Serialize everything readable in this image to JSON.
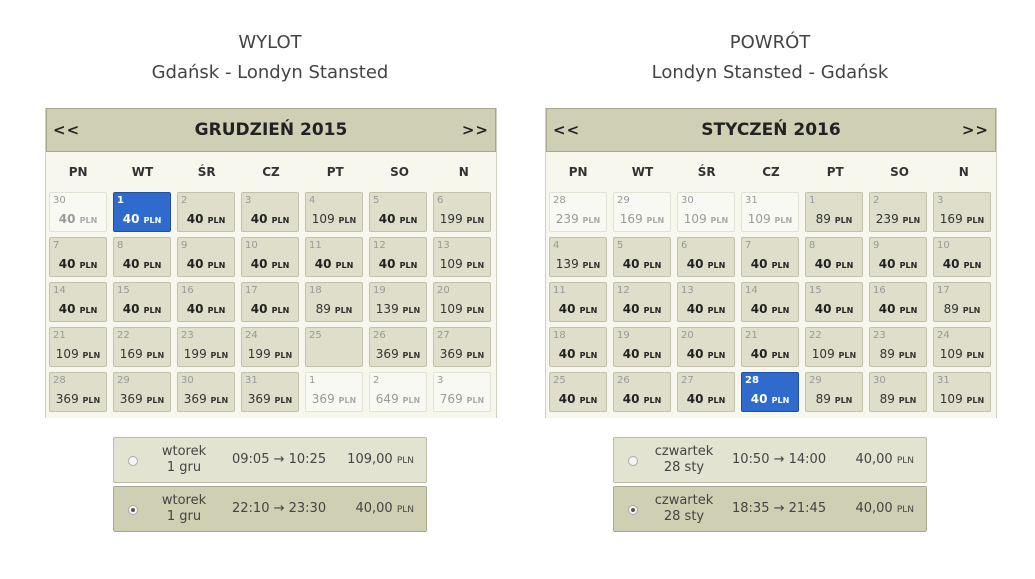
{
  "outbound": {
    "title": "WYLOT",
    "route": "Gdańsk - Londyn Stansted",
    "month": "GRUDZIEŃ 2015",
    "prev": "<<",
    "next": ">>",
    "weekdays": [
      "PN",
      "WT",
      "ŚR",
      "CZ",
      "PT",
      "SO",
      "N"
    ],
    "days": [
      {
        "d": "30",
        "price": "40",
        "bold": true,
        "state": "muted"
      },
      {
        "d": "1",
        "price": "40",
        "bold": true,
        "state": "selected"
      },
      {
        "d": "2",
        "price": "40",
        "bold": true,
        "state": "normal"
      },
      {
        "d": "3",
        "price": "40",
        "bold": true,
        "state": "normal"
      },
      {
        "d": "4",
        "price": "109",
        "bold": false,
        "state": "normal"
      },
      {
        "d": "5",
        "price": "40",
        "bold": true,
        "state": "normal"
      },
      {
        "d": "6",
        "price": "199",
        "bold": false,
        "state": "normal"
      },
      {
        "d": "7",
        "price": "40",
        "bold": true,
        "state": "normal"
      },
      {
        "d": "8",
        "price": "40",
        "bold": true,
        "state": "normal"
      },
      {
        "d": "9",
        "price": "40",
        "bold": true,
        "state": "normal"
      },
      {
        "d": "10",
        "price": "40",
        "bold": true,
        "state": "normal"
      },
      {
        "d": "11",
        "price": "40",
        "bold": true,
        "state": "normal"
      },
      {
        "d": "12",
        "price": "40",
        "bold": true,
        "state": "normal"
      },
      {
        "d": "13",
        "price": "109",
        "bold": false,
        "state": "normal"
      },
      {
        "d": "14",
        "price": "40",
        "bold": true,
        "state": "normal"
      },
      {
        "d": "15",
        "price": "40",
        "bold": true,
        "state": "normal"
      },
      {
        "d": "16",
        "price": "40",
        "bold": true,
        "state": "normal"
      },
      {
        "d": "17",
        "price": "40",
        "bold": true,
        "state": "normal"
      },
      {
        "d": "18",
        "price": "89",
        "bold": false,
        "state": "normal"
      },
      {
        "d": "19",
        "price": "139",
        "bold": false,
        "state": "normal"
      },
      {
        "d": "20",
        "price": "109",
        "bold": false,
        "state": "normal"
      },
      {
        "d": "21",
        "price": "109",
        "bold": false,
        "state": "normal"
      },
      {
        "d": "22",
        "price": "169",
        "bold": false,
        "state": "normal"
      },
      {
        "d": "23",
        "price": "199",
        "bold": false,
        "state": "normal"
      },
      {
        "d": "24",
        "price": "199",
        "bold": false,
        "state": "normal"
      },
      {
        "d": "25",
        "price": "",
        "bold": false,
        "state": "normal"
      },
      {
        "d": "26",
        "price": "369",
        "bold": false,
        "state": "normal"
      },
      {
        "d": "27",
        "price": "369",
        "bold": false,
        "state": "normal"
      },
      {
        "d": "28",
        "price": "369",
        "bold": false,
        "state": "normal"
      },
      {
        "d": "29",
        "price": "369",
        "bold": false,
        "state": "normal"
      },
      {
        "d": "30",
        "price": "369",
        "bold": false,
        "state": "normal"
      },
      {
        "d": "31",
        "price": "369",
        "bold": false,
        "state": "normal"
      },
      {
        "d": "1",
        "price": "369",
        "bold": false,
        "state": "muted"
      },
      {
        "d": "2",
        "price": "649",
        "bold": false,
        "state": "muted"
      },
      {
        "d": "3",
        "price": "769",
        "bold": false,
        "state": "muted"
      }
    ],
    "flights": [
      {
        "day": "wtorek",
        "date": "1 gru",
        "times": "09:05 → 10:25",
        "price": "109,00",
        "selected": false
      },
      {
        "day": "wtorek",
        "date": "1 gru",
        "times": "22:10 → 23:30",
        "price": "40,00",
        "selected": true
      }
    ]
  },
  "inbound": {
    "title": "POWRÓT",
    "route": "Londyn Stansted - Gdańsk",
    "month": "STYCZEŃ 2016",
    "prev": "<<",
    "next": ">>",
    "weekdays": [
      "PN",
      "WT",
      "ŚR",
      "CZ",
      "PT",
      "SO",
      "N"
    ],
    "days": [
      {
        "d": "28",
        "price": "239",
        "bold": false,
        "state": "muted"
      },
      {
        "d": "29",
        "price": "169",
        "bold": false,
        "state": "muted"
      },
      {
        "d": "30",
        "price": "109",
        "bold": false,
        "state": "muted"
      },
      {
        "d": "31",
        "price": "109",
        "bold": false,
        "state": "muted"
      },
      {
        "d": "1",
        "price": "89",
        "bold": false,
        "state": "normal"
      },
      {
        "d": "2",
        "price": "239",
        "bold": false,
        "state": "normal"
      },
      {
        "d": "3",
        "price": "169",
        "bold": false,
        "state": "normal"
      },
      {
        "d": "4",
        "price": "139",
        "bold": false,
        "state": "normal"
      },
      {
        "d": "5",
        "price": "40",
        "bold": true,
        "state": "normal"
      },
      {
        "d": "6",
        "price": "40",
        "bold": true,
        "state": "normal"
      },
      {
        "d": "7",
        "price": "40",
        "bold": true,
        "state": "normal"
      },
      {
        "d": "8",
        "price": "40",
        "bold": true,
        "state": "normal"
      },
      {
        "d": "9",
        "price": "40",
        "bold": true,
        "state": "normal"
      },
      {
        "d": "10",
        "price": "40",
        "bold": true,
        "state": "normal"
      },
      {
        "d": "11",
        "price": "40",
        "bold": true,
        "state": "normal"
      },
      {
        "d": "12",
        "price": "40",
        "bold": true,
        "state": "normal"
      },
      {
        "d": "13",
        "price": "40",
        "bold": true,
        "state": "normal"
      },
      {
        "d": "14",
        "price": "40",
        "bold": true,
        "state": "normal"
      },
      {
        "d": "15",
        "price": "40",
        "bold": true,
        "state": "normal"
      },
      {
        "d": "16",
        "price": "40",
        "bold": true,
        "state": "normal"
      },
      {
        "d": "17",
        "price": "89",
        "bold": false,
        "state": "normal"
      },
      {
        "d": "18",
        "price": "40",
        "bold": true,
        "state": "normal"
      },
      {
        "d": "19",
        "price": "40",
        "bold": true,
        "state": "normal"
      },
      {
        "d": "20",
        "price": "40",
        "bold": true,
        "state": "normal"
      },
      {
        "d": "21",
        "price": "40",
        "bold": true,
        "state": "normal"
      },
      {
        "d": "22",
        "price": "109",
        "bold": false,
        "state": "normal"
      },
      {
        "d": "23",
        "price": "89",
        "bold": false,
        "state": "normal"
      },
      {
        "d": "24",
        "price": "109",
        "bold": false,
        "state": "normal"
      },
      {
        "d": "25",
        "price": "40",
        "bold": true,
        "state": "normal"
      },
      {
        "d": "26",
        "price": "40",
        "bold": true,
        "state": "normal"
      },
      {
        "d": "27",
        "price": "40",
        "bold": true,
        "state": "normal"
      },
      {
        "d": "28",
        "price": "40",
        "bold": true,
        "state": "selected"
      },
      {
        "d": "29",
        "price": "89",
        "bold": false,
        "state": "normal"
      },
      {
        "d": "30",
        "price": "89",
        "bold": false,
        "state": "normal"
      },
      {
        "d": "31",
        "price": "109",
        "bold": false,
        "state": "normal"
      }
    ],
    "flights": [
      {
        "day": "czwartek",
        "date": "28 sty",
        "times": "10:50 → 14:00",
        "price": "40,00",
        "selected": false
      },
      {
        "day": "czwartek",
        "date": "28 sty",
        "times": "18:35 → 21:45",
        "price": "40,00",
        "selected": true
      }
    ]
  },
  "currency": "PLN",
  "colors": {
    "header": "#cfcfb6",
    "cell": "#dedecb",
    "selected": "#2f6bcc"
  }
}
